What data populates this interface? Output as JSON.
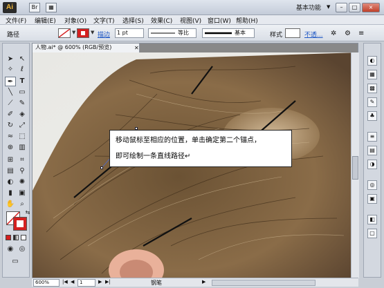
{
  "app": {
    "logo": "Ai",
    "workspace": "基本功能",
    "doc_view_toggle": "Br"
  },
  "window_controls": {
    "minimize": "–",
    "maximize": "□",
    "close": "×"
  },
  "menu": [
    "文件(F)",
    "编辑(E)",
    "对象(O)",
    "文字(T)",
    "选择(S)",
    "效果(C)",
    "视图(V)",
    "窗口(W)",
    "帮助(H)"
  ],
  "control_bar": {
    "mode_label": "路径",
    "stroke_label": "描边",
    "stroke_weight": "1 pt",
    "profile_label": "等比",
    "brush_label": "基本",
    "style_label": "样式",
    "opacity_link": "不透..."
  },
  "document": {
    "tab_title": "人物.ai* @ 600% (RGB/预览)"
  },
  "callout": {
    "line1": "移动鼠标至相应的位置，单击确定第二个锚点，",
    "line2": "即可绘制一条直线路径↵"
  },
  "status": {
    "zoom": "600%",
    "page": "1",
    "tool_name": "钢笔"
  },
  "colors": {
    "fill": "#ffffff",
    "stroke": "#d42020",
    "accent": "#1b55c4"
  }
}
